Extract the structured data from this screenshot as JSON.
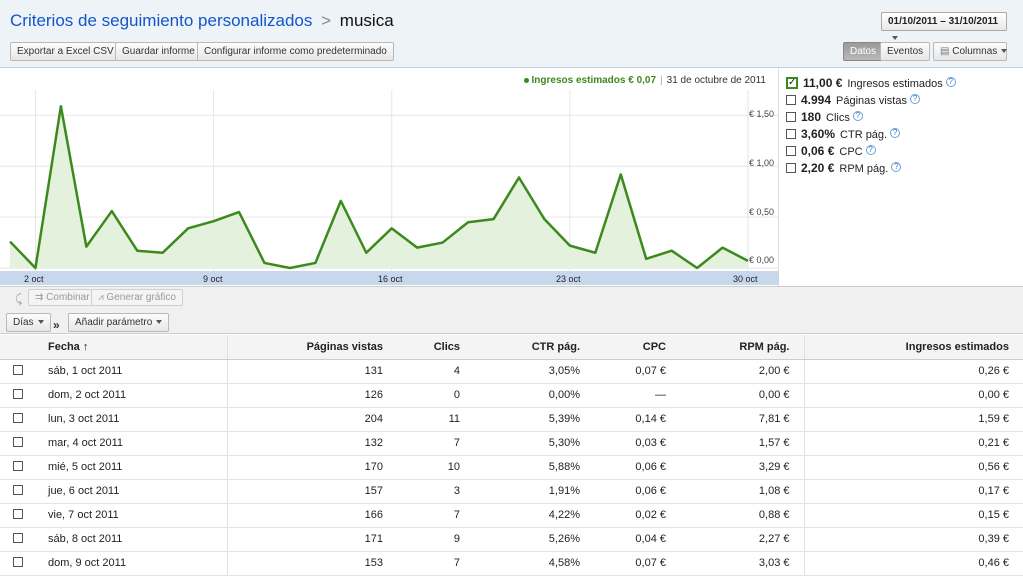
{
  "header": {
    "breadcrumb": "Criterios de seguimiento personalizados",
    "separator": ">",
    "current": "musica",
    "date_range": "01/10/2011 – 31/10/2011",
    "buttons": {
      "export": "Exportar a Excel CSV",
      "save": "Guardar informe",
      "default": "Configurar informe como predeterminado",
      "data": "Datos",
      "events": "Eventos",
      "columns": "Columnas"
    }
  },
  "chart_legend": {
    "series": "Ingresos estimados € 0,07",
    "date": "31 de octubre de 2011"
  },
  "chart_data": {
    "type": "area",
    "series": [
      {
        "name": "Ingresos estimados",
        "values": [
          0.26,
          0.0,
          1.59,
          0.21,
          0.56,
          0.17,
          0.15,
          0.39,
          0.46,
          0.55,
          0.05,
          0.0,
          0.05,
          0.66,
          0.15,
          0.39,
          0.2,
          0.25,
          0.45,
          0.48,
          0.89,
          0.48,
          0.22,
          0.15,
          0.92,
          0.09,
          0.17,
          0.0,
          0.2,
          0.07
        ]
      }
    ],
    "x_labels": [
      "2 oct",
      "9 oct",
      "16 oct",
      "23 oct",
      "30 oct"
    ],
    "y_ticks": [
      "€ 1,50",
      "€ 1,00",
      "€ 0,50",
      "€ 0,00"
    ],
    "ylim": [
      0,
      1.75
    ],
    "color": "#3c8a1e",
    "fill": "#e4f1dc"
  },
  "metrics": [
    {
      "value": "11,00 €",
      "label": "Ingresos estimados",
      "checked": true
    },
    {
      "value": "4.994",
      "label": "Páginas vistas",
      "checked": false
    },
    {
      "value": "180",
      "label": "Clics",
      "checked": false
    },
    {
      "value": "3,60%",
      "label": "CTR pág.",
      "checked": false
    },
    {
      "value": "0,06 €",
      "label": "CPC",
      "checked": false
    },
    {
      "value": "2,20 €",
      "label": "RPM pág.",
      "checked": false
    }
  ],
  "help_glyph": "?",
  "tools": {
    "combine": "Combinar",
    "generate": "Generar gráfico",
    "days": "Días",
    "add_param": "Añadir parámetro",
    "raquo": "»"
  },
  "table": {
    "headers": [
      "Fecha",
      "Páginas vistas",
      "Clics",
      "CTR pág.",
      "CPC",
      "RPM pág.",
      "Ingresos estimados"
    ],
    "sort_indicator": "↑",
    "rows": [
      [
        "sáb, 1 oct 2011",
        "131",
        "4",
        "3,05%",
        "0,07 €",
        "2,00 €",
        "0,26 €"
      ],
      [
        "dom, 2 oct 2011",
        "126",
        "0",
        "0,00%",
        "—",
        "0,00 €",
        "0,00 €"
      ],
      [
        "lun, 3 oct 2011",
        "204",
        "11",
        "5,39%",
        "0,14 €",
        "7,81 €",
        "1,59 €"
      ],
      [
        "mar, 4 oct 2011",
        "132",
        "7",
        "5,30%",
        "0,03 €",
        "1,57 €",
        "0,21 €"
      ],
      [
        "mié, 5 oct 2011",
        "170",
        "10",
        "5,88%",
        "0,06 €",
        "3,29 €",
        "0,56 €"
      ],
      [
        "jue, 6 oct 2011",
        "157",
        "3",
        "1,91%",
        "0,06 €",
        "1,08 €",
        "0,17 €"
      ],
      [
        "vie, 7 oct 2011",
        "166",
        "7",
        "4,22%",
        "0,02 €",
        "0,88 €",
        "0,15 €"
      ],
      [
        "sáb, 8 oct 2011",
        "171",
        "9",
        "5,26%",
        "0,04 €",
        "2,27 €",
        "0,39 €"
      ],
      [
        "dom, 9 oct 2011",
        "153",
        "7",
        "4,58%",
        "0,07 €",
        "3,03 €",
        "0,46 €"
      ]
    ]
  }
}
